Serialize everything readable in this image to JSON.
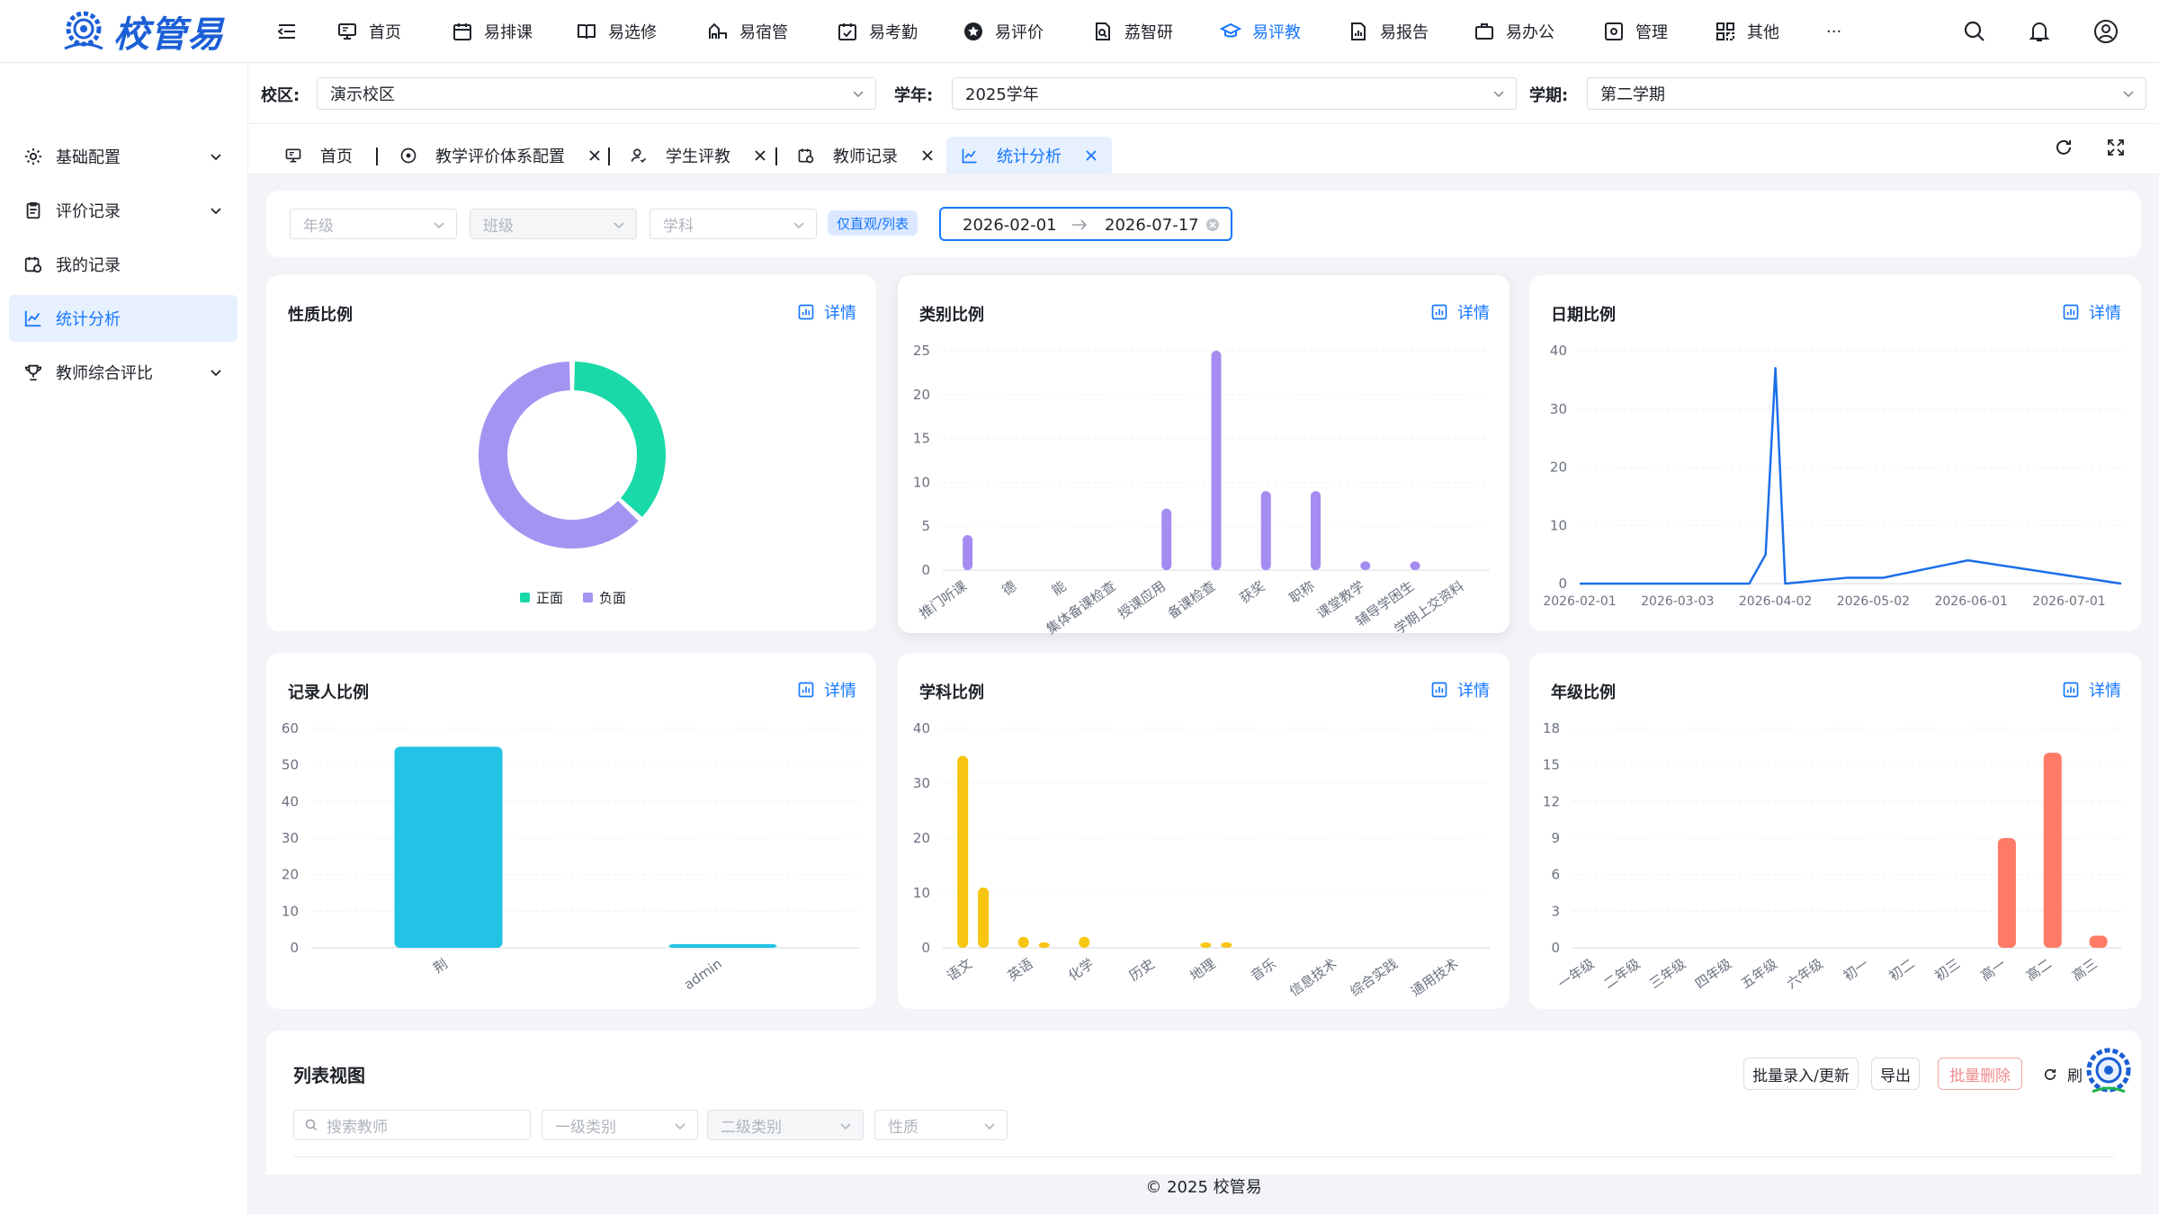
{
  "app": {
    "name": "校管易",
    "footer": "© 2025 校管易"
  },
  "colors": {
    "accent": "#1677ff",
    "positive": "#1ad9a8",
    "negative": "#a494f2",
    "category": "#a48cf0",
    "date": "#1d6fe8",
    "recorder": "#22c3e6",
    "subject": "#f8c512",
    "grade": "#ff7b67"
  },
  "topnav": [
    {
      "label": "首页",
      "icon": "monitor-icon"
    },
    {
      "label": "易排课",
      "icon": "calendar-icon"
    },
    {
      "label": "易选修",
      "icon": "book-icon"
    },
    {
      "label": "易宿管",
      "icon": "dorm-icon"
    },
    {
      "label": "易考勤",
      "icon": "check-calendar-icon"
    },
    {
      "label": "易评价",
      "icon": "star-icon"
    },
    {
      "label": "荔智研",
      "icon": "research-icon"
    },
    {
      "label": "易评教",
      "icon": "graduation-cap-icon"
    },
    {
      "label": "易报告",
      "icon": "report-icon"
    },
    {
      "label": "易办公",
      "icon": "briefcase-icon"
    },
    {
      "label": "管理",
      "icon": "settings-box-icon"
    },
    {
      "label": "其他",
      "icon": "grid-icon"
    },
    {
      "label": "···",
      "icon": ""
    }
  ],
  "topnav_active": "易评教",
  "sidebar": [
    {
      "label": "基础配置",
      "expandable": true
    },
    {
      "label": "评价记录",
      "expandable": true
    },
    {
      "label": "我的记录",
      "expandable": false
    },
    {
      "label": "统计分析",
      "expandable": false,
      "active": true
    },
    {
      "label": "教师综合评比",
      "expandable": true
    }
  ],
  "filters": {
    "campus_label": "校区:",
    "campus_value": "演示校区",
    "year_label": "学年:",
    "year_value": "2025学年",
    "term_label": "学期:",
    "term_value": "第二学期"
  },
  "tabs": [
    {
      "label": "首页",
      "closable": false
    },
    {
      "label": "教学评价体系配置",
      "closable": true
    },
    {
      "label": "学生评教",
      "closable": true
    },
    {
      "label": "教师记录",
      "closable": true
    },
    {
      "label": "统计分析",
      "closable": true,
      "active": true
    }
  ],
  "query": {
    "grade_placeholder": "年级",
    "class_placeholder": "班级",
    "subject_placeholder": "学科",
    "mode_pill": "仅直观/列表",
    "date_start": "2026-02-01",
    "date_end": "2026-07-17"
  },
  "detail_label": "详情",
  "chart_data": [
    {
      "type": "pie",
      "title": "性质比例",
      "donut": true,
      "categories": [
        "正面",
        "负面"
      ],
      "values": [
        37,
        63
      ],
      "legend": [
        "正面",
        "负面"
      ],
      "legend_position": "bottom"
    },
    {
      "type": "bar",
      "title": "类别比例",
      "categories": [
        "推门听课",
        "德",
        "能",
        "集体备课检查",
        "授课应用",
        "备课检查",
        "获奖",
        "职称",
        "课堂教学",
        "辅导学困生",
        "学期上交资料"
      ],
      "values": [
        4,
        0,
        0,
        0,
        7,
        25,
        9,
        9,
        1,
        1,
        0
      ],
      "yticks": [
        0,
        5,
        10,
        15,
        20,
        25
      ],
      "ylim": [
        0,
        25
      ],
      "grid": true
    },
    {
      "type": "line",
      "title": "日期比例",
      "x": [
        "2026-02-01",
        "2026-03-25",
        "2026-03-30",
        "2026-04-02",
        "2026-04-05",
        "2026-04-24",
        "2026-05-03",
        "2026-05-05",
        "2026-05-31",
        "2026-07-17"
      ],
      "y": [
        0,
        0,
        5,
        37,
        0,
        1,
        1,
        1,
        4,
        0
      ],
      "xticks": [
        "2026-02-01",
        "2026-03-03",
        "2026-04-02",
        "2026-05-02",
        "2026-06-01",
        "2026-07-01"
      ],
      "yticks": [
        0,
        10,
        20,
        30,
        40
      ],
      "ylim": [
        0,
        40
      ],
      "grid": true
    },
    {
      "type": "bar",
      "title": "记录人比例",
      "categories": [
        "荆",
        "admin"
      ],
      "values": [
        55,
        1
      ],
      "yticks": [
        0,
        10,
        20,
        30,
        40,
        50,
        60
      ],
      "ylim": [
        0,
        60
      ],
      "grid": true
    },
    {
      "type": "bar",
      "title": "学科比例",
      "categories": [
        "语文",
        "英语",
        "化学",
        "历史",
        "地理",
        "音乐",
        "信息技术",
        "综合实践",
        "通用技术"
      ],
      "values": [
        35,
        11,
        2,
        1,
        2,
        0,
        1,
        1,
        0,
        0,
        0,
        0
      ],
      "category_values": [
        [
          35,
          11
        ],
        [
          2,
          1
        ],
        [
          2,
          0
        ],
        [
          0,
          0
        ],
        [
          1,
          1
        ],
        [
          0,
          0
        ],
        [
          0,
          0
        ],
        [
          0,
          0
        ],
        [
          0,
          0
        ]
      ],
      "yticks": [
        0,
        10,
        20,
        30,
        40
      ],
      "ylim": [
        0,
        40
      ],
      "grid": true
    },
    {
      "type": "bar",
      "title": "年级比例",
      "categories": [
        "一年级",
        "二年级",
        "三年级",
        "四年级",
        "五年级",
        "六年级",
        "初一",
        "初二",
        "初三",
        "高一",
        "高二",
        "高三"
      ],
      "values": [
        0,
        0,
        0,
        0,
        0,
        0,
        0,
        0,
        0,
        9,
        16,
        1
      ],
      "yticks": [
        0,
        3,
        6,
        9,
        12,
        15,
        18
      ],
      "ylim": [
        0,
        18
      ],
      "grid": true
    }
  ],
  "list_view": {
    "title": "列表视图",
    "buttons": [
      "批量录入/更新",
      "导出",
      "批量删除",
      "刷"
    ],
    "search_placeholder": "搜索教师",
    "level1_placeholder": "一级类别",
    "level2_placeholder": "二级类别",
    "nature_placeholder": "性质"
  }
}
